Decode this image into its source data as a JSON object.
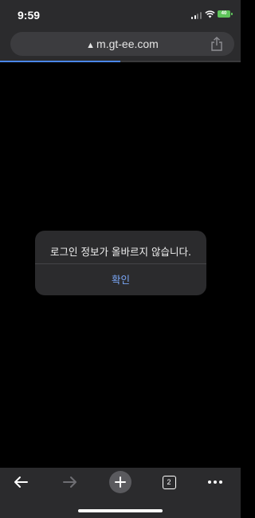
{
  "status_bar": {
    "time": "9:59",
    "battery_level": "40"
  },
  "browser": {
    "url": "m.gt-ee.com",
    "load_progress": 0.5,
    "tab_count": "2"
  },
  "dialog": {
    "message": "로그인 정보가 올바르지 않습니다.",
    "confirm_label": "확인"
  },
  "colors": {
    "chrome_background": "#2b2b2d",
    "accent_link": "#7aa7f7",
    "battery_green": "#5ec45a"
  },
  "icons": [
    "lock-icon",
    "share-icon",
    "back-icon",
    "forward-icon",
    "new-tab-icon",
    "tabs-icon",
    "more-icon",
    "wifi-icon",
    "signal-icon",
    "battery-icon"
  ]
}
